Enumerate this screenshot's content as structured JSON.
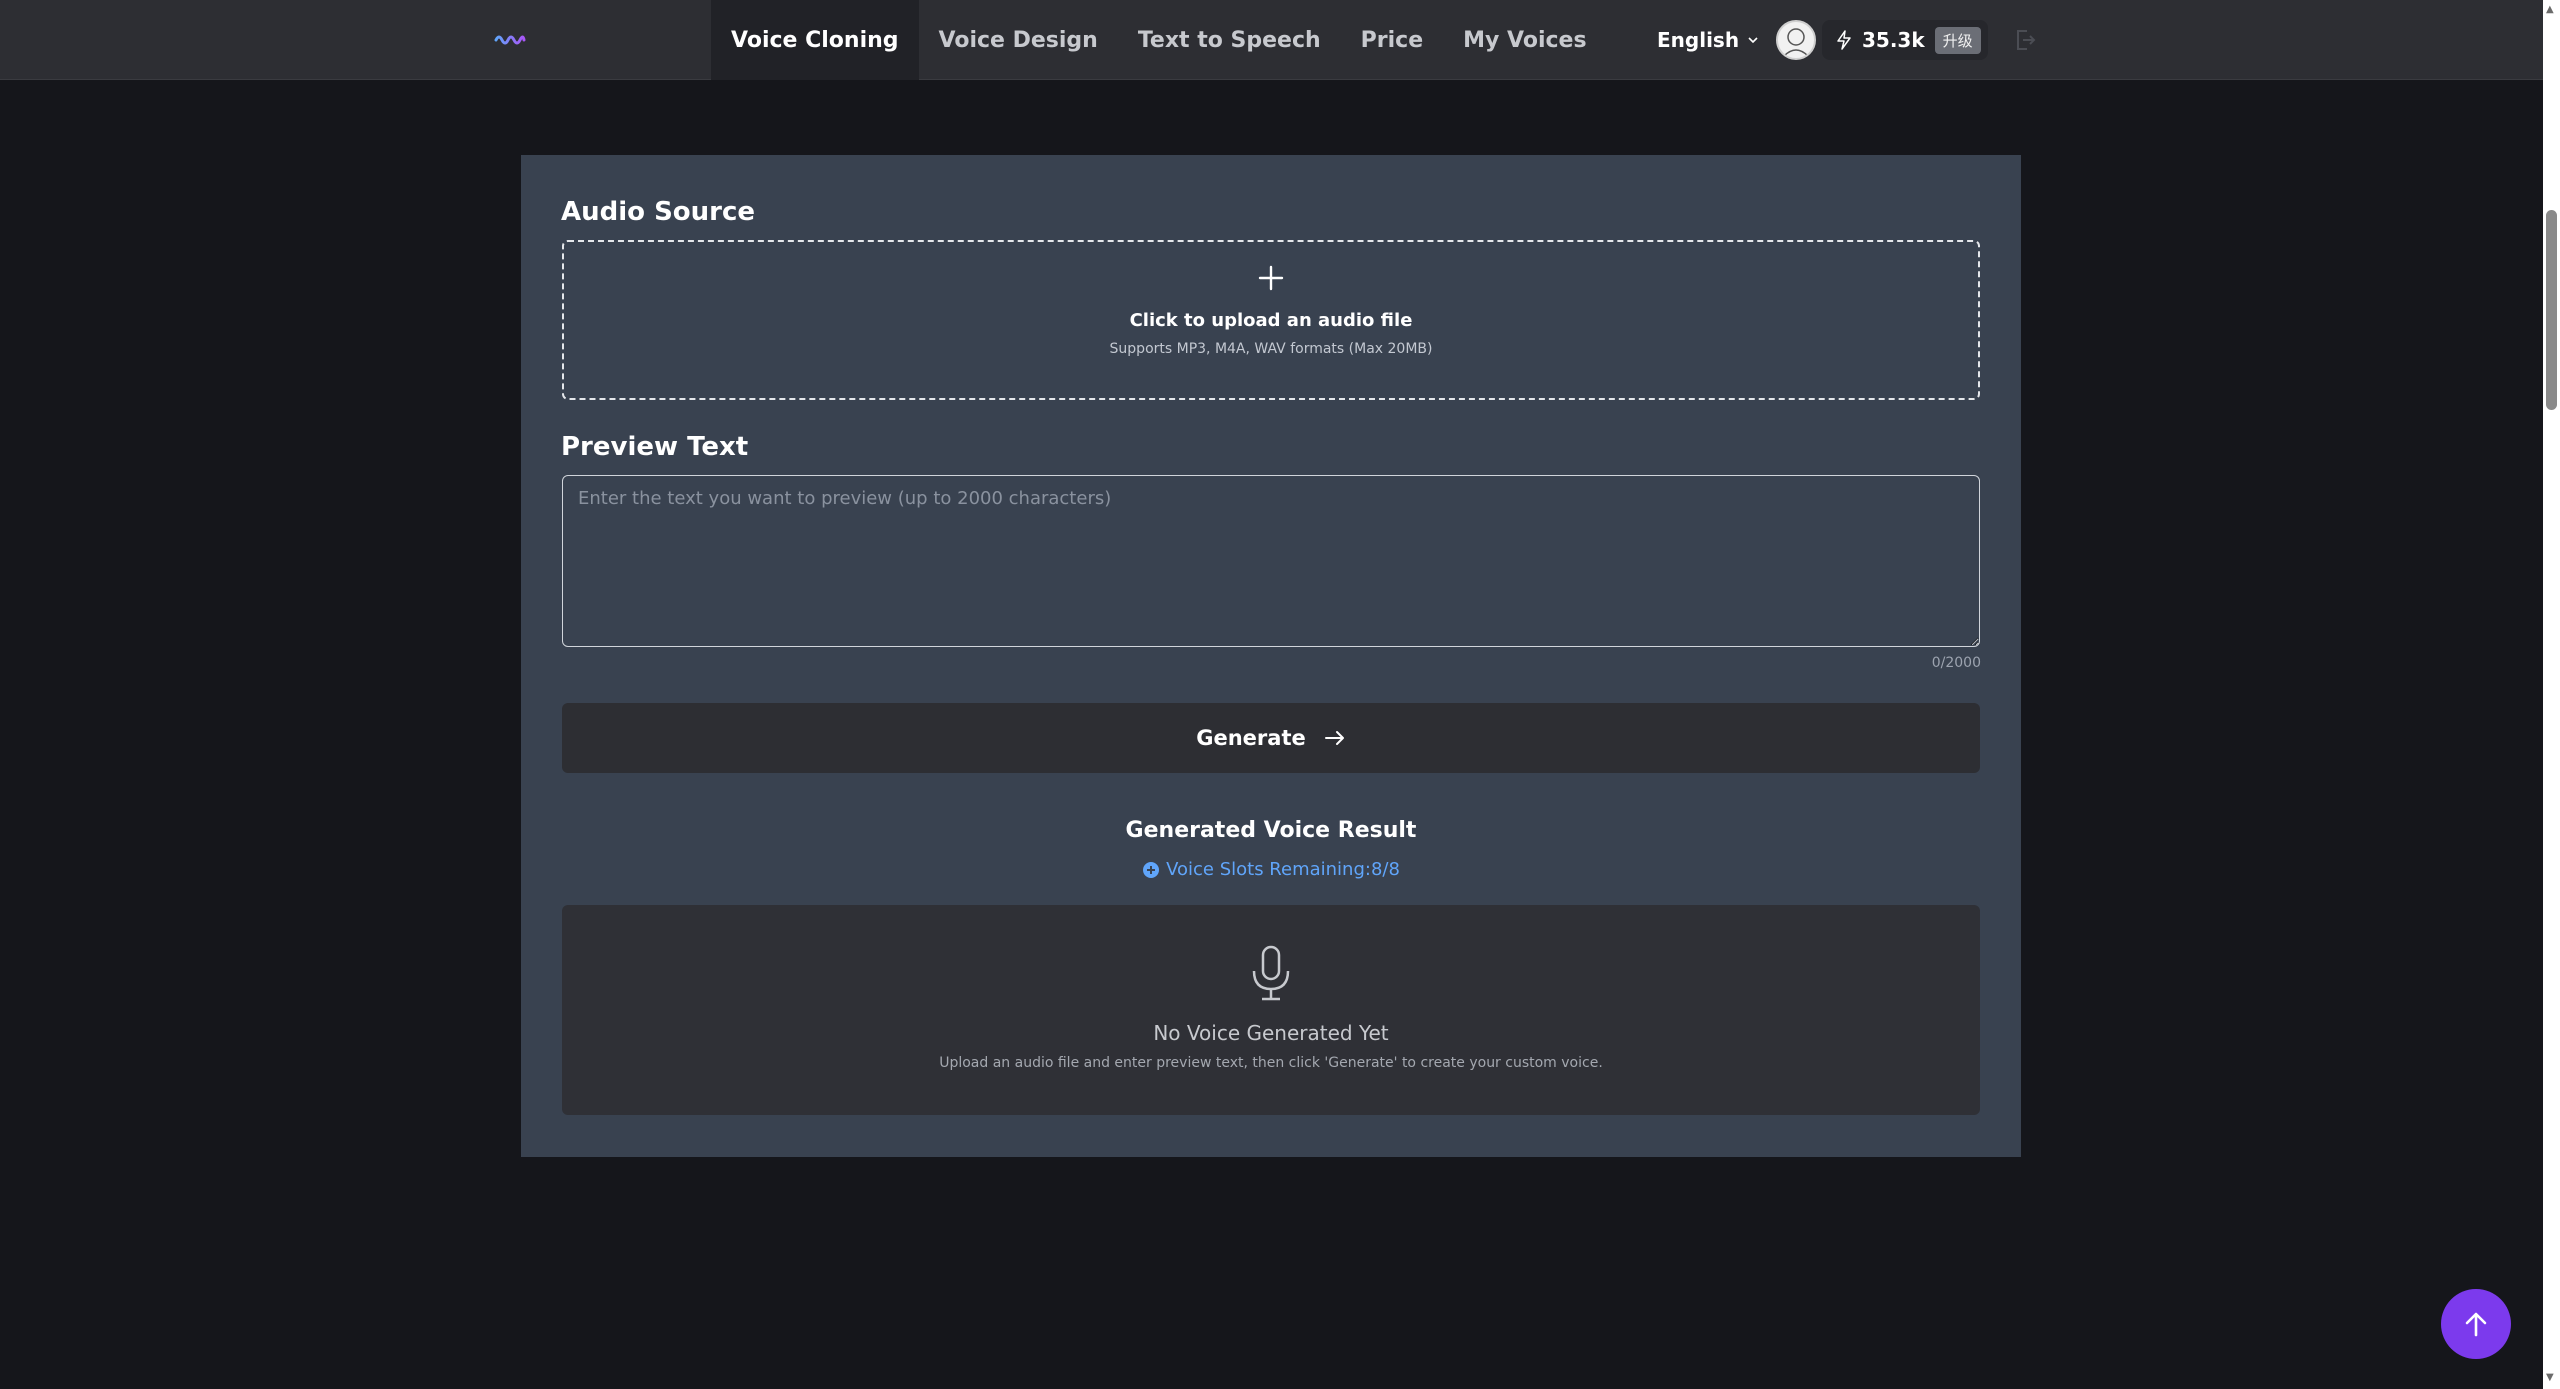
{
  "nav": {
    "items": [
      {
        "label": "Voice Cloning",
        "active": true
      },
      {
        "label": "Voice Design",
        "active": false
      },
      {
        "label": "Text to Speech",
        "active": false
      },
      {
        "label": "Price",
        "active": false
      },
      {
        "label": "My Voices",
        "active": false
      }
    ],
    "language": "English",
    "credits": "35.3k",
    "upgrade_label": "升级"
  },
  "audio_source": {
    "title": "Audio Source",
    "upload_title": "Click to upload an audio file",
    "upload_sub": "Supports MP3, M4A, WAV formats (Max 20MB)"
  },
  "preview": {
    "title": "Preview Text",
    "placeholder": "Enter the text you want to preview (up to 2000 characters)",
    "value": "",
    "count": "0/2000"
  },
  "generate_label": "Generate",
  "result": {
    "title": "Generated Voice Result",
    "slots": "Voice Slots Remaining:8/8",
    "empty_title": "No Voice Generated Yet",
    "empty_sub": "Upload an audio file and enter preview text, then click 'Generate' to create your custom voice."
  },
  "colors": {
    "accent": "#7c3aed",
    "link": "#60a5fa",
    "card": "#394250"
  }
}
